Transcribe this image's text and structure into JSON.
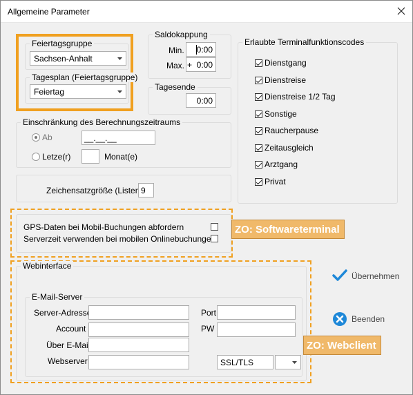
{
  "window": {
    "title": "Allgemeine Parameter"
  },
  "feiertag": {
    "group_label": "Feiertagsgruppe",
    "group_value": "Sachsen-Anhalt",
    "plan_label": "Tagesplan (Feiertagsgruppe)",
    "plan_value": "Feiertag"
  },
  "saldokappung": {
    "label": "Saldokappung",
    "min_label": "Min.",
    "min_value": "0:00",
    "max_label": "Max.",
    "max_value": "+  0:00"
  },
  "tagesende": {
    "label": "Tagesende",
    "value": "0:00"
  },
  "einschraenkung": {
    "label": "Einschränkung des Berechnungszeitraums",
    "ab_label": "Ab",
    "ab_value": "__.__.__",
    "letzte_label": "Letze(r)",
    "letzte_value": "",
    "monat_label": "Monat(e)"
  },
  "zeichensatz": {
    "label": "Zeichensatzgröße (Listen)",
    "value": "9"
  },
  "mobile": {
    "gps_label": "GPS-Daten bei Mobil-Buchungen abfordern",
    "server_label": "Serverzeit verwenden bei mobilen Onlinebuchungen"
  },
  "terminal": {
    "label": "Erlaubte Terminalfunktionscodes",
    "items": [
      {
        "label": "Dienstgang",
        "checked": true
      },
      {
        "label": "Dienstreise",
        "checked": true
      },
      {
        "label": "Dienstreise 1/2 Tag",
        "checked": true
      },
      {
        "label": "Sonstige",
        "checked": true
      },
      {
        "label": "Raucherpause",
        "checked": true
      },
      {
        "label": "Zeitausgleich",
        "checked": true
      },
      {
        "label": "Arztgang",
        "checked": true
      },
      {
        "label": "Privat",
        "checked": true
      }
    ]
  },
  "webinterface": {
    "label": "Webinterface",
    "email_label": "E-Mail-Server",
    "server_address_label": "Server-Adresse",
    "port_label": "Port",
    "account_label": "Account",
    "pw_label": "PW",
    "ueber_email_label": "Über E-Mail",
    "webserver_label": "Webserver",
    "ssl_value": "SSL/TLS"
  },
  "annotations": {
    "softwareterminal": "ZO: Softwareterminal",
    "webclient": "ZO: Webclient",
    "highlight_color": "#f0a020"
  },
  "actions": {
    "apply_label": "Übernehmen",
    "quit_label": "Beenden"
  },
  "icons": {
    "close": "close-icon",
    "apply": "checkmark-icon",
    "quit": "x-circle-icon",
    "dropdown": "chevron-down-icon"
  },
  "colors": {
    "apply": "#1e88d8",
    "quit": "#1e88d8"
  }
}
